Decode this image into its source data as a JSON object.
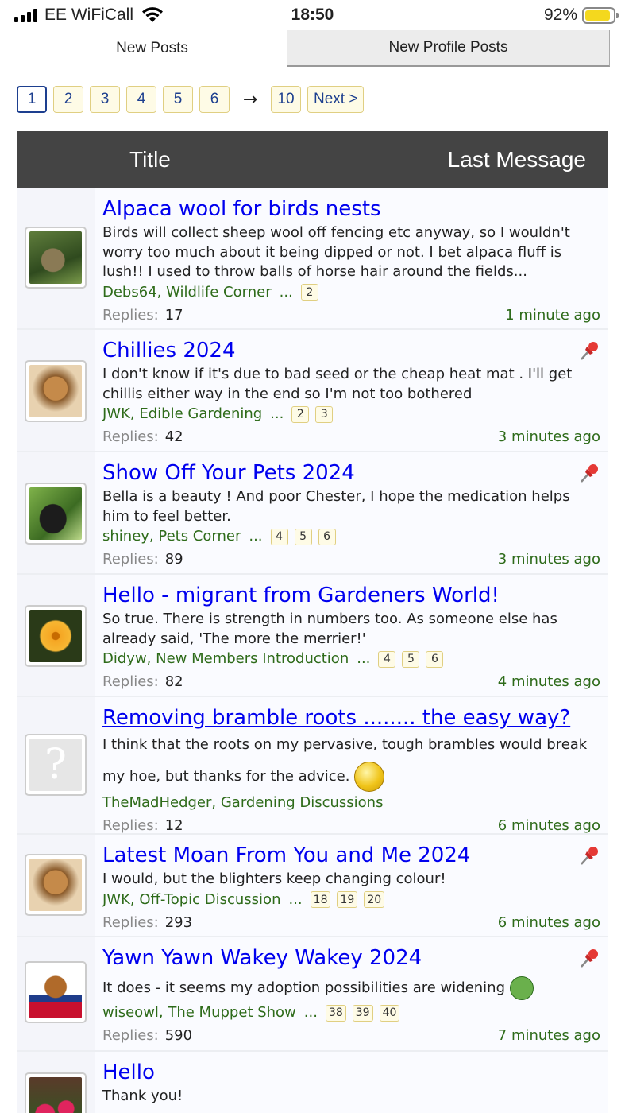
{
  "status_bar": {
    "carrier": "EE WiFiCall",
    "time": "18:50",
    "battery": "92%",
    "battery_level": 0.92
  },
  "tabs": [
    {
      "label": "New Posts",
      "active": true
    },
    {
      "label": "New Profile Posts",
      "active": false
    }
  ],
  "pagination": {
    "pages": [
      "1",
      "2",
      "3",
      "4",
      "5",
      "6"
    ],
    "current": "1",
    "arrow": "→",
    "last": "10",
    "next": "Next >"
  },
  "table_header": {
    "title": "Title",
    "last_message": "Last Message"
  },
  "threads": [
    {
      "title": "Alpaca wool for birds nests",
      "snippet": "Birds will collect sheep wool off fencing etc anyway, so I wouldn't worry too much about it being dipped or not. I bet alpaca fluff is lush!! I used to throw balls of horse hair around the fields...",
      "author_forum": "Debs64, Wildlife Corner",
      "ellipsis": "...",
      "pages": [
        "2"
      ],
      "replies_label": "Replies:",
      "replies": "17",
      "time": "1 minute ago",
      "pinned": false,
      "avatar": "tortoise-avatar"
    },
    {
      "title": "Chillies 2024",
      "snippet": "I don't know if it's due to bad seed or the cheap heat mat . I'll get chillis either way in the end so I'm not too bothered",
      "author_forum": "JWK, Edible Gardening",
      "ellipsis": "...",
      "pages": [
        "2",
        "3"
      ],
      "replies_label": "Replies:",
      "replies": "42",
      "time": "3 minutes ago",
      "pinned": true,
      "avatar": "muppet-avatar"
    },
    {
      "title": "Show Off Your Pets 2024",
      "snippet": "Bella is a beauty ! And poor Chester, I hope the medication helps him to feel better.",
      "author_forum": "shiney, Pets Corner",
      "ellipsis": "...",
      "pages": [
        "4",
        "5",
        "6"
      ],
      "replies_label": "Replies:",
      "replies": "89",
      "time": "3 minutes ago",
      "pinned": true,
      "avatar": "gorilla-avatar"
    },
    {
      "title": "Hello - migrant from Gardeners World!",
      "snippet": "So true. There is strength in numbers too. As someone else has already said, 'The more the merrier!'",
      "author_forum": "Didyw, New Members Introduction",
      "ellipsis": "...",
      "pages": [
        "4",
        "5",
        "6"
      ],
      "replies_label": "Replies:",
      "replies": "82",
      "time": "4 minutes ago",
      "pinned": false,
      "avatar": "flower-avatar"
    },
    {
      "title": "Removing bramble roots ........ the easy way?",
      "snippet": "I think that the roots on my pervasive, tough brambles would break my hoe, but thanks for the advice.",
      "author_forum": "TheMadHedger, Gardening Discussions",
      "ellipsis": "",
      "pages": [],
      "replies_label": "Replies:",
      "replies": "12",
      "time": "6 minutes ago",
      "pinned": false,
      "avatar": "unknown-avatar"
    },
    {
      "title": "Latest Moan From You and Me 2024",
      "snippet": "I would, but the blighters keep changing colour!",
      "author_forum": "JWK, Off-Topic Discussion",
      "ellipsis": "...",
      "pages": [
        "18",
        "19",
        "20"
      ],
      "replies_label": "Replies:",
      "replies": "293",
      "time": "6 minutes ago",
      "pinned": true,
      "avatar": "muppet-avatar"
    },
    {
      "title": "Yawn Yawn Wakey Wakey 2024",
      "snippet": "It does - it seems my adoption possibilities are widening",
      "author_forum": "wiseowl, The Muppet Show",
      "ellipsis": "...",
      "pages": [
        "38",
        "39",
        "40"
      ],
      "replies_label": "Replies:",
      "replies": "590",
      "time": "7 minutes ago",
      "pinned": true,
      "avatar": "owl-avatar"
    },
    {
      "title": "Hello",
      "snippet": "Thank you!",
      "author_forum": "",
      "ellipsis": "",
      "pages": [],
      "replies_label": "",
      "replies": "",
      "time": "",
      "pinned": false,
      "avatar": "red-flowers-avatar"
    }
  ]
}
